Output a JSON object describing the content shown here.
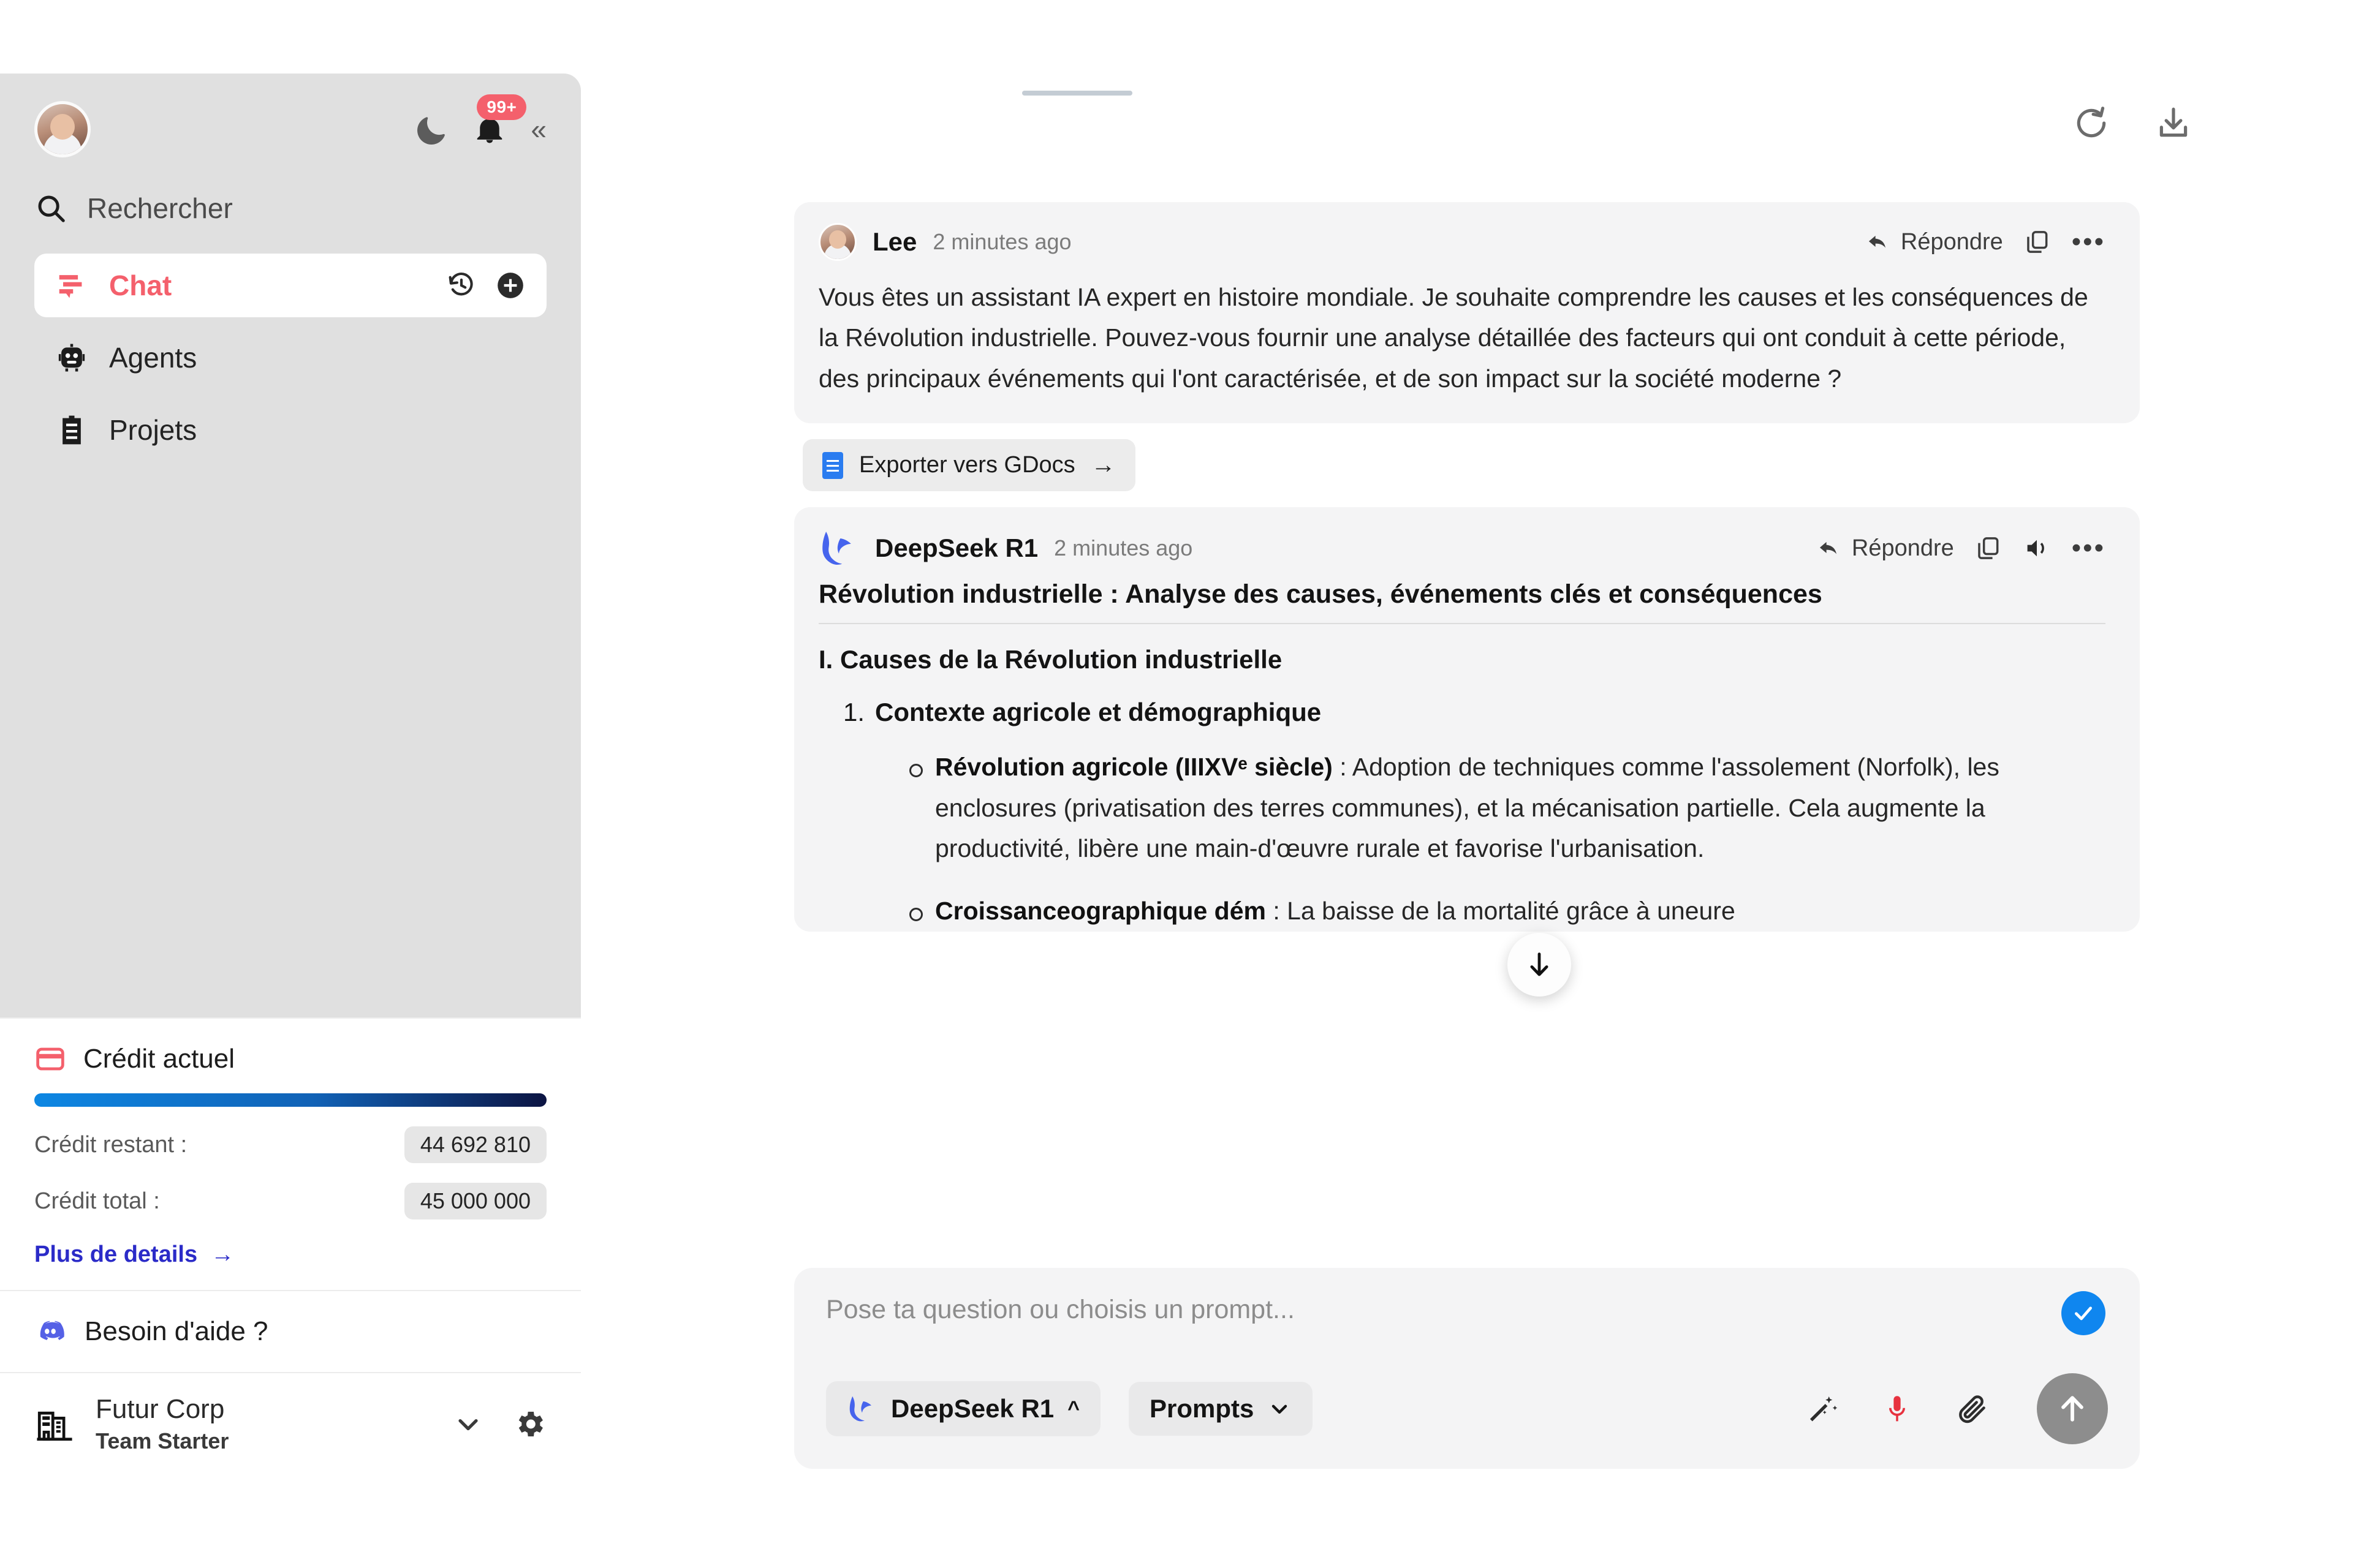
{
  "sidebar": {
    "notifications_badge": "99+",
    "search": {
      "label": "Rechercher",
      "icon": "search-icon"
    },
    "nav": [
      {
        "label": "Chat",
        "icon": "chat-icon",
        "active": true,
        "trailing": [
          "history-icon",
          "plus-circle-icon"
        ]
      },
      {
        "label": "Agents",
        "icon": "robot-icon",
        "active": false
      },
      {
        "label": "Projets",
        "icon": "clipboard-icon",
        "active": false
      }
    ],
    "credit": {
      "title": "Crédit actuel",
      "icon": "credit-card-icon",
      "remaining_label": "Crédit restant :",
      "remaining_value": "44 692 810",
      "total_label": "Crédit total :",
      "total_value": "45 000 000",
      "more_details": "Plus de details",
      "more_details_arrow": "→",
      "bar_colors": [
        "#0d87e3",
        "#0c1442"
      ]
    },
    "help": {
      "label": "Besoin d'aide ?",
      "icon": "discord-icon"
    },
    "org": {
      "name": "Futur Corp",
      "plan": "Team Starter",
      "icon": "building-icon",
      "chevron": "chevron-down-icon",
      "settings": "gear-icon"
    }
  },
  "main": {
    "tools": [
      {
        "name": "refresh-icon"
      },
      {
        "name": "download-icon"
      }
    ]
  },
  "messages": [
    {
      "author": "Lee",
      "time": "2 minutes ago",
      "reply_label": "Répondre",
      "text": "Vous êtes un assistant IA expert en histoire mondiale. Je souhaite comprendre les causes et les conséquences de la Révolution industrielle. Pouvez-vous fournir une analyse détaillée des facteurs qui ont conduit à cette période, des principaux événements qui l'ont caractérisée, et de son impact sur la société moderne ?"
    }
  ],
  "export": {
    "label": "Exporter vers GDocs",
    "arrow": "→",
    "icon": "google-docs-icon"
  },
  "answer": {
    "author": "DeepSeek R1",
    "time": "2 minutes ago",
    "reply_label": "Répondre",
    "title": "Révolution industrielle : Analyse des causes, événements clés et conséquences",
    "section_1": "I. Causes de la Révolution industrielle",
    "item_1": "Contexte agricole et démographique",
    "bullets": [
      {
        "lead": "Révolution agricole (IIIXVᵉ siècle)",
        "rest": " : Adoption de techniques comme l'assolement (Norfolk), les enclosures (privatisation des terres communes), et la mécanisation partielle. Cela augmente la productivité, libère une main-d'œuvre rurale et favorise l'urbanisation."
      },
      {
        "lead": "Croissanceographique dém",
        "rest": " : La baisse de la mortalité grâce à uneure"
      }
    ]
  },
  "composer": {
    "placeholder": "Pose ta question ou choisis un prompt...",
    "model_pill": {
      "label": "DeepSeek R1",
      "chevron": "chevron-up-icon"
    },
    "prompts_pill": {
      "label": "Prompts",
      "chevron": "chevron-down-icon"
    },
    "tools": [
      "magic-wand-icon",
      "microphone-icon",
      "paperclip-icon"
    ],
    "send": "send-arrow-up-icon",
    "status_check": "check-circle-icon"
  },
  "colors": {
    "accent_red": "#f4606c",
    "link_blue": "#2b2bc8",
    "sidebar_bg": "#e0e0e0",
    "bubble_bg": "#f4f4f5"
  }
}
